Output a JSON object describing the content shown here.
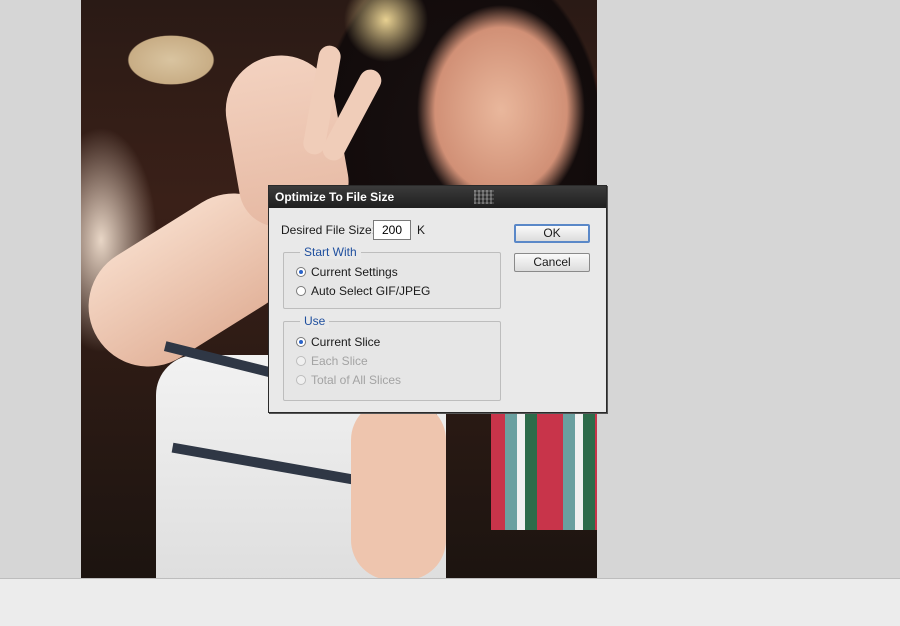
{
  "dialog": {
    "title": "Optimize To File Size",
    "desired_size_label": "Desired File Size:",
    "desired_size_value": "200",
    "unit": "K",
    "ok_label": "OK",
    "cancel_label": "Cancel",
    "start_with": {
      "title": "Start With",
      "options": [
        {
          "label": "Current Settings",
          "selected": true,
          "enabled": true
        },
        {
          "label": "Auto Select GIF/JPEG",
          "selected": false,
          "enabled": true
        }
      ]
    },
    "use": {
      "title": "Use",
      "options": [
        {
          "label": "Current Slice",
          "selected": true,
          "enabled": true
        },
        {
          "label": "Each Slice",
          "selected": false,
          "enabled": false
        },
        {
          "label": "Total of All Slices",
          "selected": false,
          "enabled": false
        }
      ]
    }
  },
  "colors": {
    "accent": "#1f4f9e",
    "titlebar": "#2a2a2a",
    "radio_fill": "#2a63c8"
  }
}
